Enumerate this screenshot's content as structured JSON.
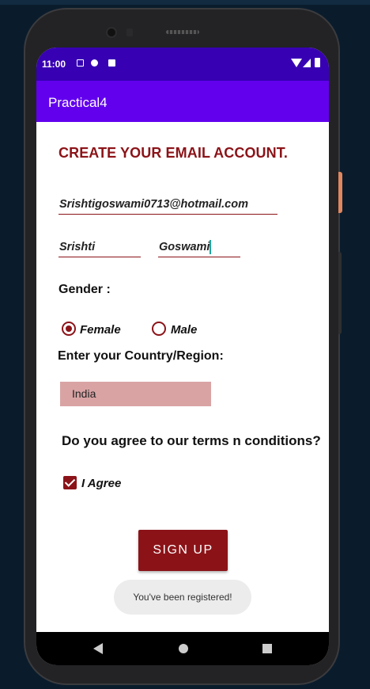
{
  "status_bar": {
    "time": "11:00"
  },
  "app_bar": {
    "title": "Practical4"
  },
  "form": {
    "heading": "CREATE YOUR EMAIL ACCOUNT.",
    "email_value": "Srishtigoswami0713@hotmail.com",
    "first_name_value": "Srishti",
    "last_name_value": "Goswami",
    "gender_label": "Gender :",
    "gender_options": [
      {
        "label": "Female",
        "checked": true
      },
      {
        "label": "Male",
        "checked": false
      }
    ],
    "country_label": "Enter your Country/Region:",
    "country_selected": "India",
    "terms_label": "Do you agree to our terms n conditions?",
    "agree_label": "I Agree",
    "agree_checked": true,
    "signup_label": "SIGN UP"
  },
  "toast": {
    "message": "You've been registered!"
  },
  "colors": {
    "accent": "#8b1318",
    "appbar": "#6200ee",
    "statusbar": "#3700b3",
    "select_bg": "#d9a3a4"
  },
  "icons": {
    "status": [
      "notification-a-icon",
      "notification-b-icon",
      "sd-card-icon",
      "wifi-icon",
      "signal-icon",
      "battery-icon"
    ],
    "nav": [
      "back-icon",
      "home-icon",
      "recents-icon"
    ]
  }
}
